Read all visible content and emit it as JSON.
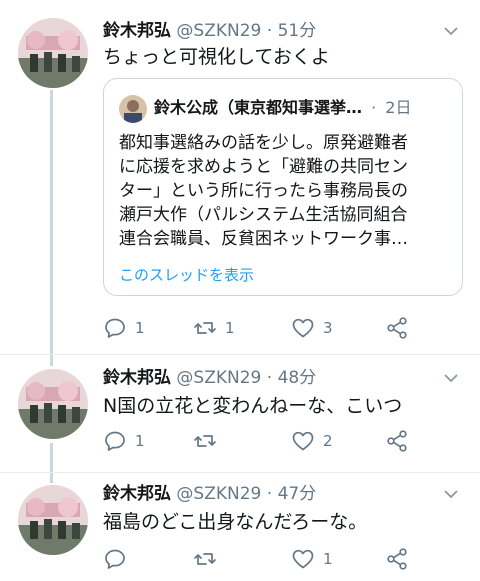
{
  "colors": {
    "accent": "#1da1f2",
    "muted": "#657786",
    "border": "#ccd6dd",
    "text": "#14171a"
  },
  "tweets": [
    {
      "name": "鈴木邦弘",
      "handle": "@SZKN29",
      "sep": "·",
      "time": "51分",
      "text": "ちょっと可視化しておくよ",
      "quote": {
        "name": "鈴木公成（東京都知事選挙…",
        "sep": "·",
        "time": "2日",
        "lines": [
          "都知事選絡みの話を少し。原発避難者",
          "に応援を求めようと「避難の共同セン",
          "ター」という所に行ったら事務局長の",
          "瀬戸大作（パルシステム生活協同組合",
          "連合会職員、反貧困ネットワーク事…"
        ],
        "thread_link": "このスレッドを表示"
      },
      "replies": "1",
      "retweets": "1",
      "likes": "3"
    },
    {
      "name": "鈴木邦弘",
      "handle": "@SZKN29",
      "sep": "·",
      "time": "48分",
      "text": "N国の立花と変わんねーな、こいつ",
      "replies": "1",
      "retweets": "",
      "likes": "2"
    },
    {
      "name": "鈴木邦弘",
      "handle": "@SZKN29",
      "sep": "·",
      "time": "47分",
      "text": "福島のどこ出身なんだろーな。",
      "replies": "",
      "retweets": "",
      "likes": "1"
    }
  ]
}
